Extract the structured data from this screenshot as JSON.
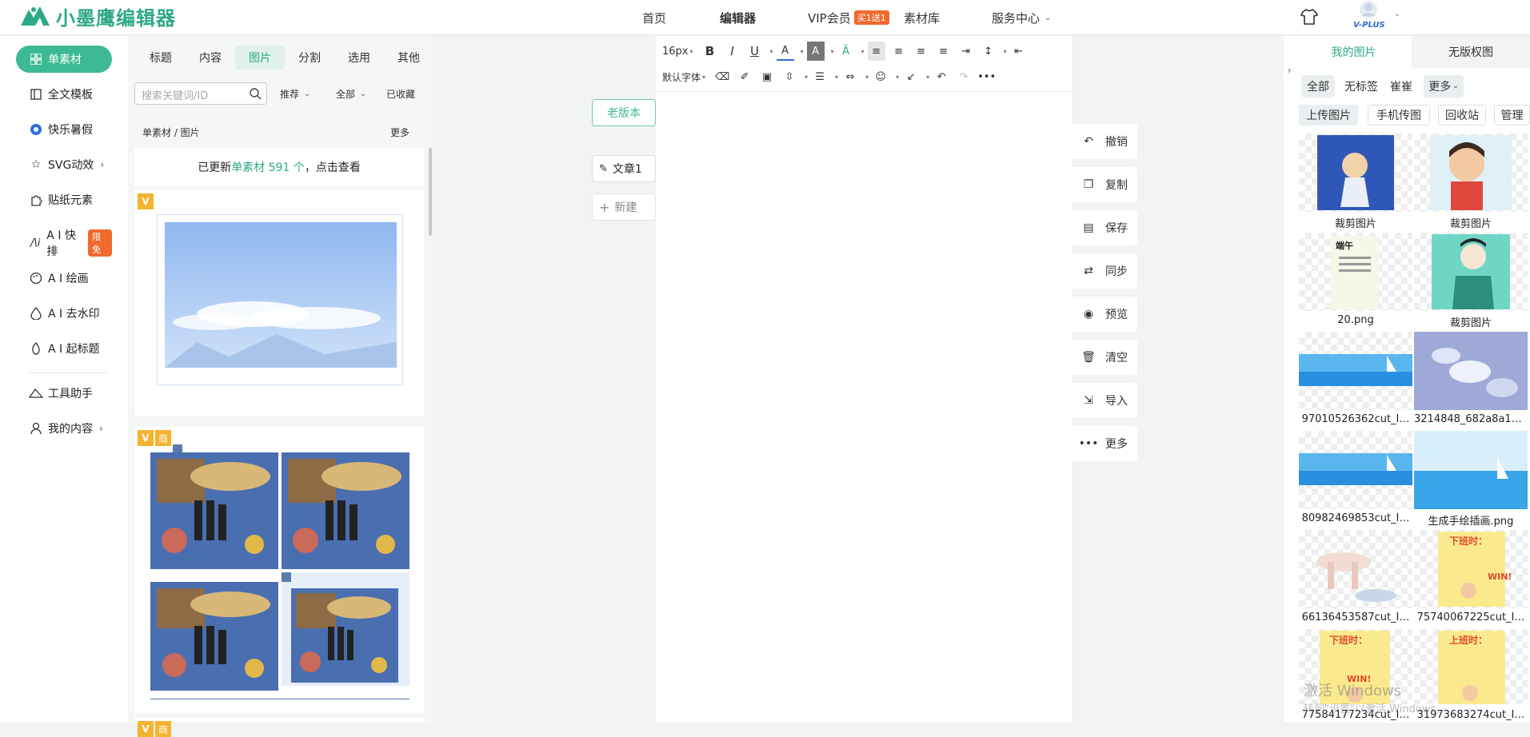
{
  "brand": {
    "name": "小墨鹰编辑器",
    "accent": "#3dba93"
  },
  "nav": {
    "home": "首页",
    "editor": "编辑器",
    "vip": "VIP会员",
    "vip_badge": "买1送1",
    "assets": "素材库",
    "service": "服务中心"
  },
  "user": {
    "avatar_label": "V-PLUS"
  },
  "leftnav": {
    "items": [
      {
        "label": "单素材",
        "icon": "grid-icon"
      },
      {
        "label": "全文模板",
        "icon": "template-icon"
      },
      {
        "label": "快乐暑假",
        "icon": "ball-icon"
      },
      {
        "label": "SVG动效",
        "icon": "star-icon"
      },
      {
        "label": "贴纸元素",
        "icon": "puzzle-icon"
      },
      {
        "label": "A I 快排",
        "icon": "ai-icon",
        "badge": "限免"
      },
      {
        "label": "A I 绘画",
        "icon": "palette-icon"
      },
      {
        "label": "A I 去水印",
        "icon": "drop-icon"
      },
      {
        "label": "A I 起标题",
        "icon": "fire-icon"
      },
      {
        "label": "工具助手",
        "icon": "tool-icon"
      },
      {
        "label": "我的内容",
        "icon": "user-icon"
      }
    ]
  },
  "material": {
    "tabs": [
      "标题",
      "内容",
      "图片",
      "分割",
      "选用",
      "其他"
    ],
    "search_placeholder": "搜索关键词/ID",
    "filter_recommend": "推荐",
    "filter_all": "全部",
    "filter_fav": "已收藏",
    "breadcrumb": "单素材 / 图片",
    "more": "更多",
    "updated_prefix": "已更新",
    "updated_highlight": "单素材 591 个",
    "updated_suffix": "，点击查看",
    "badge_v": "V",
    "badge_shang": "商"
  },
  "docs": {
    "old_version": "老版本",
    "doc1": "文章1",
    "new": "新建"
  },
  "toolbar": {
    "font_size": "16px",
    "font_family": "默认字体"
  },
  "actions": [
    "撤销",
    "复制",
    "保存",
    "同步",
    "预览",
    "清空",
    "导入",
    "更多"
  ],
  "rightpanel": {
    "tab_mine": "我的图片",
    "tab_free": "无版权图",
    "filters": [
      "全部",
      "无标签",
      "崔崔",
      "更多"
    ],
    "buttons": [
      "上传图片",
      "手机传图",
      "回收站",
      "管理"
    ],
    "images": [
      "裁剪图片",
      "裁剪图片",
      "20.png",
      "裁剪图片",
      "97010526362cut_I…",
      "3214848_682a8a12…",
      "80982469853cut_I…",
      "生成手绘插画.png",
      "66136453587cut_I…",
      "75740067225cut_I…",
      "77584177234cut_I…",
      "31973683274cut_I…"
    ]
  },
  "watermark": {
    "line1": "激活 Windows",
    "line2": "转到\"设置\"以激活 Windows。"
  }
}
